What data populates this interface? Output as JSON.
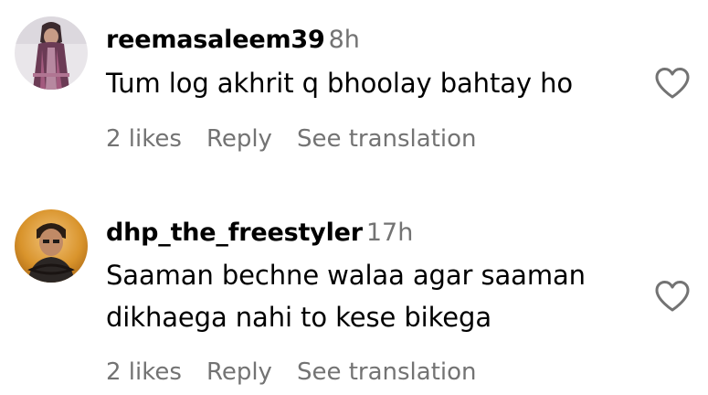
{
  "comments": [
    {
      "username": "reemasaleem39",
      "time": "8h",
      "text": "Tum log akhrit q bhoolay bahtay ho",
      "likes": "2 likes",
      "reply": "Reply",
      "translate": "See translation",
      "avatar_icon": "user-photo-avatar",
      "like_icon": "heart-outline-icon"
    },
    {
      "username": "dhp_the_freestyler",
      "time": "17h",
      "text": "Saaman bechne walaa agar saaman dikhaega nahi to kese bikega",
      "likes": "2 likes",
      "reply": "Reply",
      "translate": "See translation",
      "avatar_icon": "user-photo-avatar",
      "like_icon": "heart-outline-icon"
    }
  ],
  "colors": {
    "text": "#000000",
    "secondary": "#737373",
    "background": "#ffffff"
  }
}
